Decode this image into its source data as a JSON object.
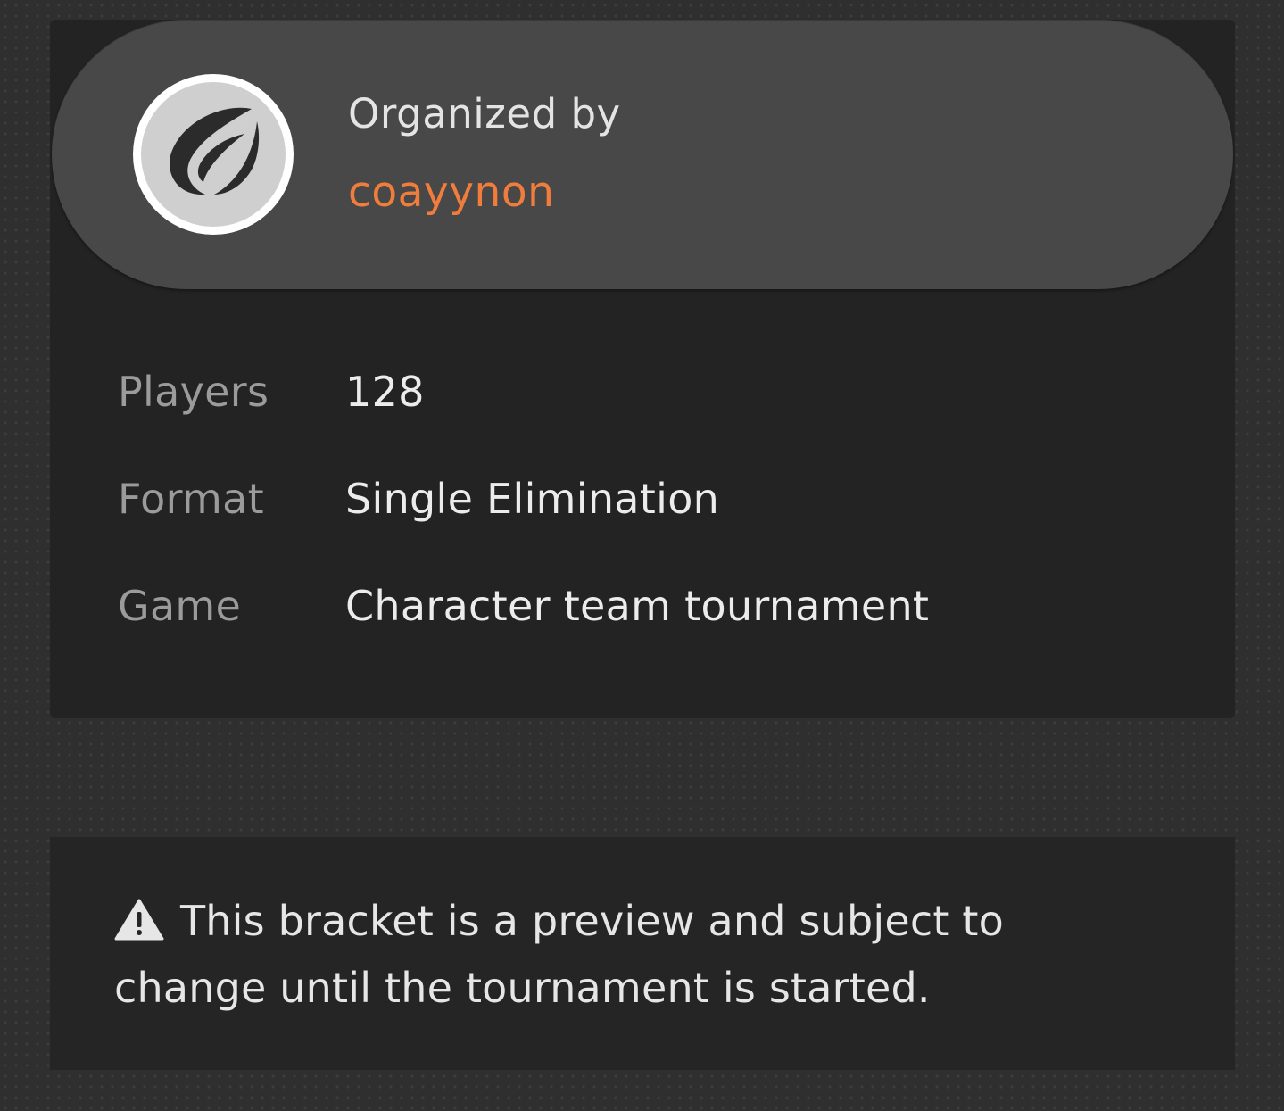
{
  "organizer": {
    "label": "Organized by",
    "name": "coayynon",
    "avatar_icon": "wing-logo-icon",
    "name_color": "#f07d3c"
  },
  "details": [
    {
      "label": "Players",
      "value": "128"
    },
    {
      "label": "Format",
      "value": "Single Elimination"
    },
    {
      "label": "Game",
      "value": "Character team tournament"
    }
  ],
  "notice": {
    "icon": "warning-icon",
    "line1": "This bracket is a preview and subject to",
    "line2": "change until the tournament is started."
  }
}
